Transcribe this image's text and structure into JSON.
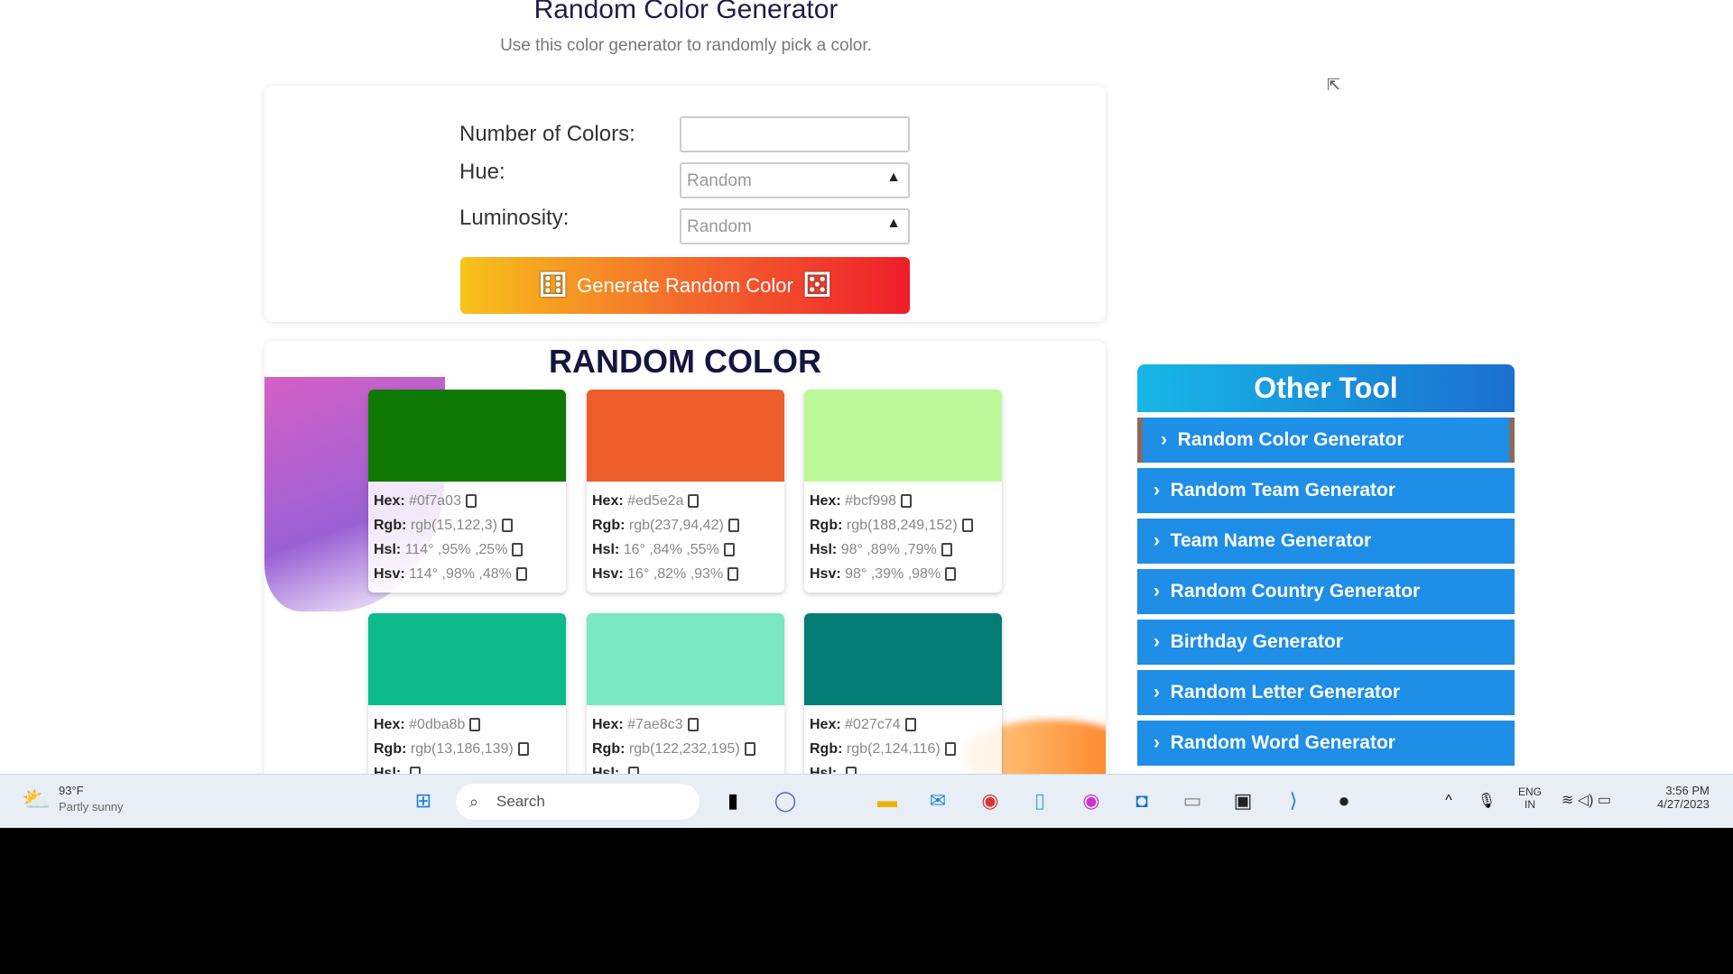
{
  "page": {
    "title": "Random Color Generator",
    "subtitle": "Use this color generator to randomly pick a color."
  },
  "form": {
    "num_label": "Number of Colors:",
    "num_value": "",
    "hue_label": "Hue:",
    "hue_value": "Random",
    "lum_label": "Luminosity:",
    "lum_value": "Random",
    "generate_label": "Generate Random Color"
  },
  "results": {
    "title": "RANDOM COLOR",
    "labels": {
      "hex": "Hex:",
      "rgb": "Rgb:",
      "hsl": "Hsl:",
      "hsv": "Hsv:"
    },
    "swatches": [
      {
        "color": "#0f7a03",
        "hex": "#0f7a03",
        "rgb": "rgb(15,122,3)",
        "hsl": "114° ,95% ,25%",
        "hsv": "114° ,98% ,48%"
      },
      {
        "color": "#ed5e2a",
        "hex": "#ed5e2a",
        "rgb": "rgb(237,94,42)",
        "hsl": "16° ,84% ,55%",
        "hsv": "16° ,82% ,93%"
      },
      {
        "color": "#bcf998",
        "hex": "#bcf998",
        "rgb": "rgb(188,249,152)",
        "hsl": "98° ,89% ,79%",
        "hsv": "98° ,39% ,98%"
      },
      {
        "color": "#0dba8b",
        "hex": "#0dba8b",
        "rgb": "rgb(13,186,139)",
        "hsl": "",
        "hsv": ""
      },
      {
        "color": "#7ae8c3",
        "hex": "#7ae8c3",
        "rgb": "rgb(122,232,195)",
        "hsl": "",
        "hsv": ""
      },
      {
        "color": "#027c74",
        "hex": "#027c74",
        "rgb": "rgb(2,124,116)",
        "hsl": "",
        "hsv": ""
      }
    ]
  },
  "sidebar": {
    "title": "Other Tool",
    "items": [
      "Random Color Generator",
      "Random Team Generator",
      "Team Name Generator",
      "Random Country Generator",
      "Birthday Generator",
      "Random Letter Generator",
      "Random Word Generator"
    ]
  },
  "taskbar": {
    "weather_temp": "93°F",
    "weather_desc": "Partly sunny",
    "search_placeholder": "Search",
    "lang": "ENG",
    "region": "IN",
    "time": "3:56 PM",
    "date": "4/27/2023"
  }
}
